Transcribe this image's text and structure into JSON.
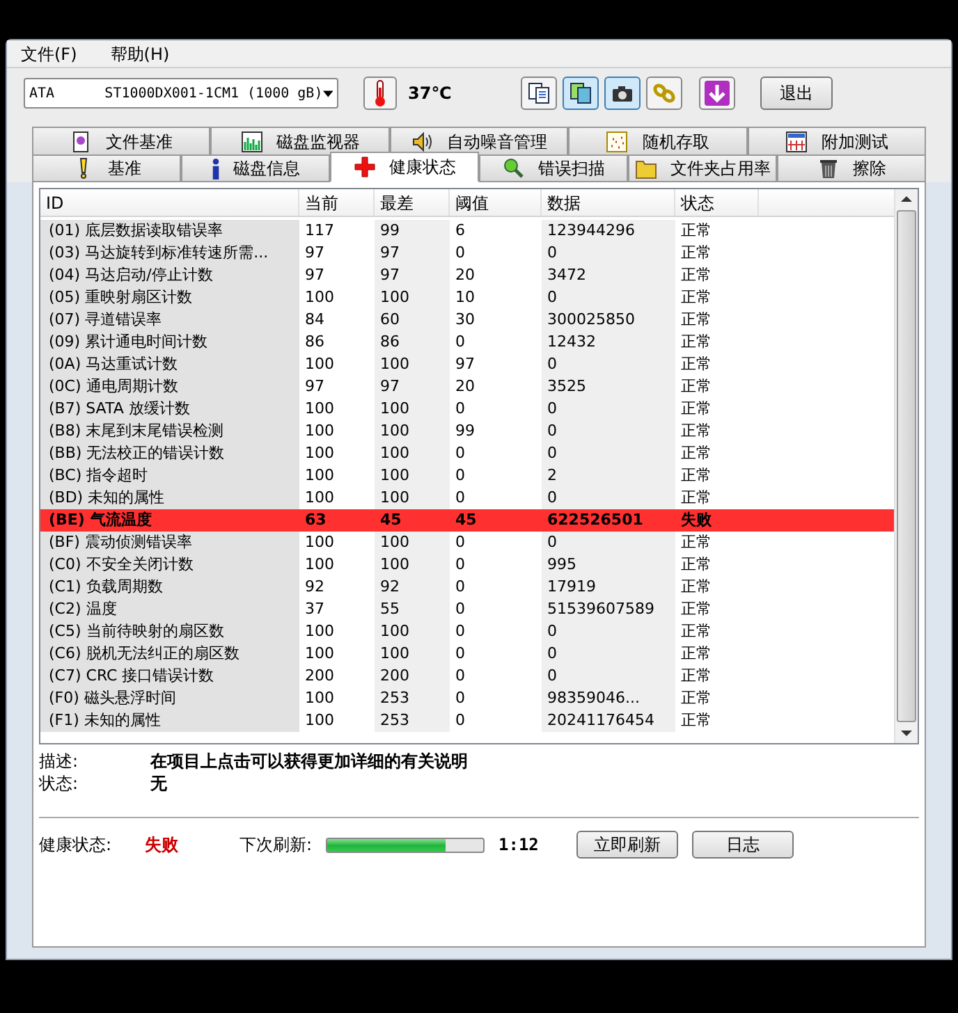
{
  "menu": [
    {
      "label": "文件(F)"
    },
    {
      "label": "帮助(H)"
    }
  ],
  "toolbar": {
    "drive": "ATA      ST1000DX001-1CM1 (1000 gB)",
    "temperature": "37℃",
    "tools": [
      {
        "kind": "copy",
        "selected": false
      },
      {
        "kind": "copy-color",
        "selected": true
      },
      {
        "kind": "camera",
        "selected": true
      },
      {
        "kind": "chain",
        "selected": false
      },
      {
        "kind": "download",
        "selected": false
      }
    ],
    "exit": "退出"
  },
  "tabs_top": [
    {
      "label": "文件基准",
      "kind": "file"
    },
    {
      "label": "磁盘监视器",
      "kind": "bars"
    },
    {
      "label": "自动噪音管理",
      "kind": "speaker"
    },
    {
      "label": "随机存取",
      "kind": "scatter"
    },
    {
      "label": "附加测试",
      "kind": "grid"
    }
  ],
  "tabs_bottom": [
    {
      "label": "基准",
      "kind": "bulb",
      "selected": false
    },
    {
      "label": "磁盘信息",
      "kind": "info",
      "selected": false
    },
    {
      "label": "健康状态",
      "kind": "cross",
      "selected": true
    },
    {
      "label": "错误扫描",
      "kind": "magnifier",
      "selected": false
    },
    {
      "label": "文件夹占用率",
      "kind": "folder",
      "selected": false
    },
    {
      "label": "擦除",
      "kind": "trash",
      "selected": false
    }
  ],
  "table": {
    "columns": [
      "ID",
      "当前",
      "最差",
      "阈值",
      "数据",
      "状态"
    ],
    "rows": [
      {
        "cells": [
          "(01) 底层数据读取错误率",
          "117",
          "99",
          "6",
          "123944296",
          "正常"
        ],
        "failed": false
      },
      {
        "cells": [
          "(03) 马达旋转到标准转速所需...",
          "97",
          "97",
          "0",
          "0",
          "正常"
        ],
        "failed": false
      },
      {
        "cells": [
          "(04) 马达启动/停止计数",
          "97",
          "97",
          "20",
          "3472",
          "正常"
        ],
        "failed": false
      },
      {
        "cells": [
          "(05) 重映射扇区计数",
          "100",
          "100",
          "10",
          "0",
          "正常"
        ],
        "failed": false
      },
      {
        "cells": [
          "(07) 寻道错误率",
          "84",
          "60",
          "30",
          "300025850",
          "正常"
        ],
        "failed": false
      },
      {
        "cells": [
          "(09) 累计通电时间计数",
          "86",
          "86",
          "0",
          "12432",
          "正常"
        ],
        "failed": false
      },
      {
        "cells": [
          "(0A) 马达重试计数",
          "100",
          "100",
          "97",
          "0",
          "正常"
        ],
        "failed": false
      },
      {
        "cells": [
          "(0C) 通电周期计数",
          "97",
          "97",
          "20",
          "3525",
          "正常"
        ],
        "failed": false
      },
      {
        "cells": [
          "(B7) SATA 放缓计数",
          "100",
          "100",
          "0",
          "0",
          "正常"
        ],
        "failed": false
      },
      {
        "cells": [
          "(B8) 末尾到末尾错误检测",
          "100",
          "100",
          "99",
          "0",
          "正常"
        ],
        "failed": false
      },
      {
        "cells": [
          "(BB) 无法校正的错误计数",
          "100",
          "100",
          "0",
          "0",
          "正常"
        ],
        "failed": false
      },
      {
        "cells": [
          "(BC) 指令超时",
          "100",
          "100",
          "0",
          "2",
          "正常"
        ],
        "failed": false
      },
      {
        "cells": [
          "(BD) 未知的属性",
          "100",
          "100",
          "0",
          "0",
          "正常"
        ],
        "failed": false
      },
      {
        "cells": [
          "(BE) 气流温度",
          "63",
          "45",
          "45",
          "622526501",
          "失败"
        ],
        "failed": true
      },
      {
        "cells": [
          "(BF) 震动侦测错误率",
          "100",
          "100",
          "0",
          "0",
          "正常"
        ],
        "failed": false
      },
      {
        "cells": [
          "(C0) 不安全关闭计数",
          "100",
          "100",
          "0",
          "995",
          "正常"
        ],
        "failed": false
      },
      {
        "cells": [
          "(C1) 负载周期数",
          "92",
          "92",
          "0",
          "17919",
          "正常"
        ],
        "failed": false
      },
      {
        "cells": [
          "(C2) 温度",
          "37",
          "55",
          "0",
          "51539607589",
          "正常"
        ],
        "failed": false
      },
      {
        "cells": [
          "(C5) 当前待映射的扇区数",
          "100",
          "100",
          "0",
          "0",
          "正常"
        ],
        "failed": false
      },
      {
        "cells": [
          "(C6) 脱机无法纠正的扇区数",
          "100",
          "100",
          "0",
          "0",
          "正常"
        ],
        "failed": false
      },
      {
        "cells": [
          "(C7) CRC 接口错误计数",
          "200",
          "200",
          "0",
          "0",
          "正常"
        ],
        "failed": false
      },
      {
        "cells": [
          "(F0) 磁头悬浮时间",
          "100",
          "253",
          "0",
          "98359046...",
          "正常"
        ],
        "failed": false
      },
      {
        "cells": [
          "(F1) 未知的属性",
          "100",
          "253",
          "0",
          "20241176454",
          "正常"
        ],
        "failed": false
      }
    ]
  },
  "details": [
    {
      "label": "描述:",
      "value": "在项目上点击可以获得更加详细的有关说明"
    },
    {
      "label": "状态:",
      "value": "无"
    }
  ],
  "footer": {
    "health_label": "健康状态:",
    "health_value": "失败",
    "refresh_label": "下次刷新:",
    "level": 0.76,
    "countdown": "1:12",
    "refresh_button": "立即刷新",
    "log_button": "日志"
  }
}
